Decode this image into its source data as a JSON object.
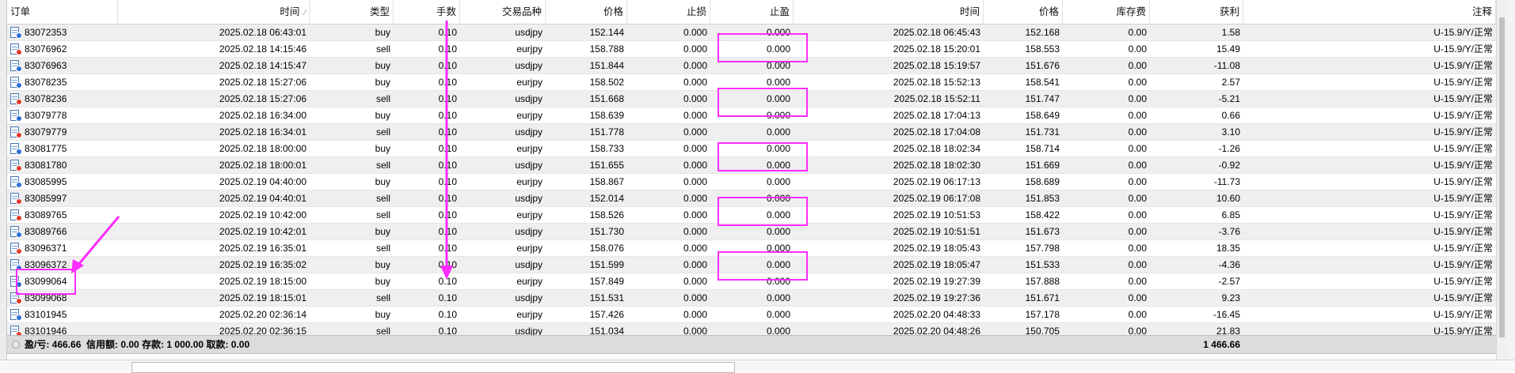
{
  "columns": {
    "order": "订单",
    "time": "时间",
    "type": "类型",
    "lots": "手数",
    "symbol": "交易品种",
    "price": "价格",
    "sl": "止损",
    "tp": "止盈",
    "close_time": "时间",
    "close_price": "价格",
    "swap": "库存费",
    "profit": "获利",
    "comment": "注释"
  },
  "colors": {
    "annotation": "#ff2bff",
    "buy_dot": "#2f6fd6",
    "sell_dot": "#e03a2a"
  },
  "rows": [
    {
      "order": "83072353",
      "time": "2025.02.18 06:43:01",
      "type": "buy",
      "lots": "0.10",
      "symbol": "usdjpy",
      "price": "152.144",
      "sl": "0.000",
      "tp": "0.000",
      "close_time": "2025.02.18 06:45:43",
      "close_price": "152.168",
      "swap": "0.00",
      "profit": "1.58",
      "comment": "U-15.9/Y/正常"
    },
    {
      "order": "83076962",
      "time": "2025.02.18 14:15:46",
      "type": "sell",
      "lots": "0.10",
      "symbol": "eurjpy",
      "price": "158.788",
      "sl": "0.000",
      "tp": "0.000",
      "close_time": "2025.02.18 15:20:01",
      "close_price": "158.553",
      "swap": "0.00",
      "profit": "15.49",
      "comment": "U-15.9/Y/正常"
    },
    {
      "order": "83076963",
      "time": "2025.02.18 14:15:47",
      "type": "buy",
      "lots": "0.10",
      "symbol": "usdjpy",
      "price": "151.844",
      "sl": "0.000",
      "tp": "0.000",
      "close_time": "2025.02.18 15:19:57",
      "close_price": "151.676",
      "swap": "0.00",
      "profit": "-11.08",
      "comment": "U-15.9/Y/正常"
    },
    {
      "order": "83078235",
      "time": "2025.02.18 15:27:06",
      "type": "buy",
      "lots": "0.10",
      "symbol": "eurjpy",
      "price": "158.502",
      "sl": "0.000",
      "tp": "0.000",
      "close_time": "2025.02.18 15:52:13",
      "close_price": "158.541",
      "swap": "0.00",
      "profit": "2.57",
      "comment": "U-15.9/Y/正常"
    },
    {
      "order": "83078236",
      "time": "2025.02.18 15:27:06",
      "type": "sell",
      "lots": "0.10",
      "symbol": "usdjpy",
      "price": "151.668",
      "sl": "0.000",
      "tp": "0.000",
      "close_time": "2025.02.18 15:52:11",
      "close_price": "151.747",
      "swap": "0.00",
      "profit": "-5.21",
      "comment": "U-15.9/Y/正常"
    },
    {
      "order": "83079778",
      "time": "2025.02.18 16:34:00",
      "type": "buy",
      "lots": "0.10",
      "symbol": "eurjpy",
      "price": "158.639",
      "sl": "0.000",
      "tp": "0.000",
      "close_time": "2025.02.18 17:04:13",
      "close_price": "158.649",
      "swap": "0.00",
      "profit": "0.66",
      "comment": "U-15.9/Y/正常"
    },
    {
      "order": "83079779",
      "time": "2025.02.18 16:34:01",
      "type": "sell",
      "lots": "0.10",
      "symbol": "usdjpy",
      "price": "151.778",
      "sl": "0.000",
      "tp": "0.000",
      "close_time": "2025.02.18 17:04:08",
      "close_price": "151.731",
      "swap": "0.00",
      "profit": "3.10",
      "comment": "U-15.9/Y/正常"
    },
    {
      "order": "83081775",
      "time": "2025.02.18 18:00:00",
      "type": "buy",
      "lots": "0.10",
      "symbol": "eurjpy",
      "price": "158.733",
      "sl": "0.000",
      "tp": "0.000",
      "close_time": "2025.02.18 18:02:34",
      "close_price": "158.714",
      "swap": "0.00",
      "profit": "-1.26",
      "comment": "U-15.9/Y/正常"
    },
    {
      "order": "83081780",
      "time": "2025.02.18 18:00:01",
      "type": "sell",
      "lots": "0.10",
      "symbol": "usdjpy",
      "price": "151.655",
      "sl": "0.000",
      "tp": "0.000",
      "close_time": "2025.02.18 18:02:30",
      "close_price": "151.669",
      "swap": "0.00",
      "profit": "-0.92",
      "comment": "U-15.9/Y/正常"
    },
    {
      "order": "83085995",
      "time": "2025.02.19 04:40:00",
      "type": "buy",
      "lots": "0.10",
      "symbol": "eurjpy",
      "price": "158.867",
      "sl": "0.000",
      "tp": "0.000",
      "close_time": "2025.02.19 06:17:13",
      "close_price": "158.689",
      "swap": "0.00",
      "profit": "-11.73",
      "comment": "U-15.9/Y/正常"
    },
    {
      "order": "83085997",
      "time": "2025.02.19 04:40:01",
      "type": "sell",
      "lots": "0.10",
      "symbol": "usdjpy",
      "price": "152.014",
      "sl": "0.000",
      "tp": "0.000",
      "close_time": "2025.02.19 06:17:08",
      "close_price": "151.853",
      "swap": "0.00",
      "profit": "10.60",
      "comment": "U-15.9/Y/正常"
    },
    {
      "order": "83089765",
      "time": "2025.02.19 10:42:00",
      "type": "sell",
      "lots": "0.10",
      "symbol": "eurjpy",
      "price": "158.526",
      "sl": "0.000",
      "tp": "0.000",
      "close_time": "2025.02.19 10:51:53",
      "close_price": "158.422",
      "swap": "0.00",
      "profit": "6.85",
      "comment": "U-15.9/Y/正常"
    },
    {
      "order": "83089766",
      "time": "2025.02.19 10:42:01",
      "type": "buy",
      "lots": "0.10",
      "symbol": "usdjpy",
      "price": "151.730",
      "sl": "0.000",
      "tp": "0.000",
      "close_time": "2025.02.19 10:51:51",
      "close_price": "151.673",
      "swap": "0.00",
      "profit": "-3.76",
      "comment": "U-15.9/Y/正常"
    },
    {
      "order": "83096371",
      "time": "2025.02.19 16:35:01",
      "type": "sell",
      "lots": "0.10",
      "symbol": "eurjpy",
      "price": "158.076",
      "sl": "0.000",
      "tp": "0.000",
      "close_time": "2025.02.19 18:05:43",
      "close_price": "157.798",
      "swap": "0.00",
      "profit": "18.35",
      "comment": "U-15.9/Y/正常"
    },
    {
      "order": "83096372",
      "time": "2025.02.19 16:35:02",
      "type": "buy",
      "lots": "0.10",
      "symbol": "usdjpy",
      "price": "151.599",
      "sl": "0.000",
      "tp": "0.000",
      "close_time": "2025.02.19 18:05:47",
      "close_price": "151.533",
      "swap": "0.00",
      "profit": "-4.36",
      "comment": "U-15.9/Y/正常"
    },
    {
      "order": "83099064",
      "time": "2025.02.19 18:15:00",
      "type": "buy",
      "lots": "0.10",
      "symbol": "eurjpy",
      "price": "157.849",
      "sl": "0.000",
      "tp": "0.000",
      "close_time": "2025.02.19 19:27:39",
      "close_price": "157.888",
      "swap": "0.00",
      "profit": "-2.57",
      "comment": "U-15.9/Y/正常"
    },
    {
      "order": "83099068",
      "time": "2025.02.19 18:15:01",
      "type": "sell",
      "lots": "0.10",
      "symbol": "usdjpy",
      "price": "151.531",
      "sl": "0.000",
      "tp": "0.000",
      "close_time": "2025.02.19 19:27:36",
      "close_price": "151.671",
      "swap": "0.00",
      "profit": "9.23",
      "comment": "U-15.9/Y/正常"
    },
    {
      "order": "83101945",
      "time": "2025.02.20 02:36:14",
      "type": "buy",
      "lots": "0.10",
      "symbol": "eurjpy",
      "price": "157.426",
      "sl": "0.000",
      "tp": "0.000",
      "close_time": "2025.02.20 04:48:33",
      "close_price": "157.178",
      "swap": "0.00",
      "profit": "-16.45",
      "comment": "U-15.9/Y/正常"
    },
    {
      "order": "83101946",
      "time": "2025.02.20 02:36:15",
      "type": "sell",
      "lots": "0.10",
      "symbol": "usdjpy",
      "price": "151.034",
      "sl": "0.000",
      "tp": "0.000",
      "close_time": "2025.02.20 04:48:26",
      "close_price": "150.705",
      "swap": "0.00",
      "profit": "21.83",
      "comment": "U-15.9/Y/正常"
    }
  ],
  "summary": {
    "pl_label": "盈/亏: 466.66",
    "rest": "信用额: 0.00  存款: 1 000.00  取款: 0.00",
    "total_profit": "1 466.66"
  }
}
